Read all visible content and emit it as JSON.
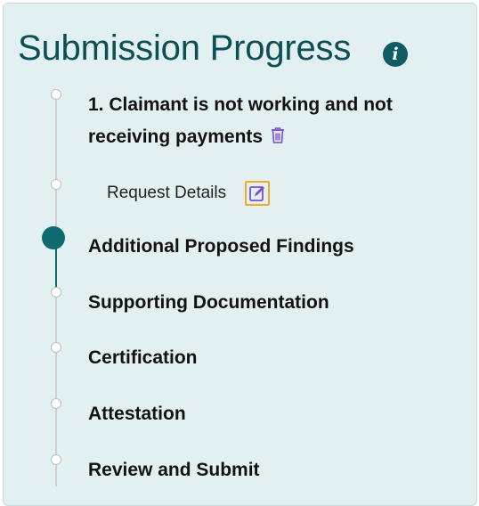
{
  "title": "Submission Progress",
  "info_icon_glyph": "i",
  "steps": [
    {
      "label": "1. Claimant is not working and not receiving payments",
      "status": "completed"
    },
    {
      "label": "Request Details",
      "status": "completed",
      "sub": true
    },
    {
      "label": "Additional Proposed Findings",
      "status": "current"
    },
    {
      "label": "Supporting Documentation",
      "status": "pending"
    },
    {
      "label": "Certification",
      "status": "pending"
    },
    {
      "label": "Attestation",
      "status": "pending"
    },
    {
      "label": "Review and Submit",
      "status": "pending"
    }
  ],
  "icons": {
    "info": "info-icon",
    "delete": "trash-icon",
    "edit": "edit-icon"
  },
  "colors": {
    "title": "#0d4f56",
    "accent": "#0f6b70",
    "panel_bg": "#e3f0f1",
    "action_icon": "#7b4fcf",
    "focus_ring": "#f0a925"
  }
}
